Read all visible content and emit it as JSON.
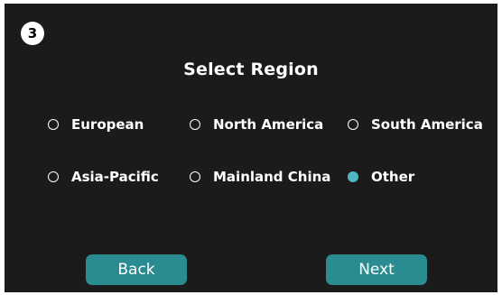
{
  "step": {
    "number": "3"
  },
  "page": {
    "title": "Select Region"
  },
  "regions": [
    {
      "label": "European",
      "selected": false
    },
    {
      "label": "North America",
      "selected": false
    },
    {
      "label": "South America",
      "selected": false
    },
    {
      "label": "Asia-Pacific",
      "selected": false
    },
    {
      "label": "Mainland China",
      "selected": false
    },
    {
      "label": "Other",
      "selected": true
    }
  ],
  "buttons": {
    "back_label": "Back",
    "next_label": "Next"
  },
  "colors": {
    "background": "#1c1b1b",
    "accent": "#4fb6c4",
    "button": "#2a8c91",
    "text": "#ffffff"
  }
}
